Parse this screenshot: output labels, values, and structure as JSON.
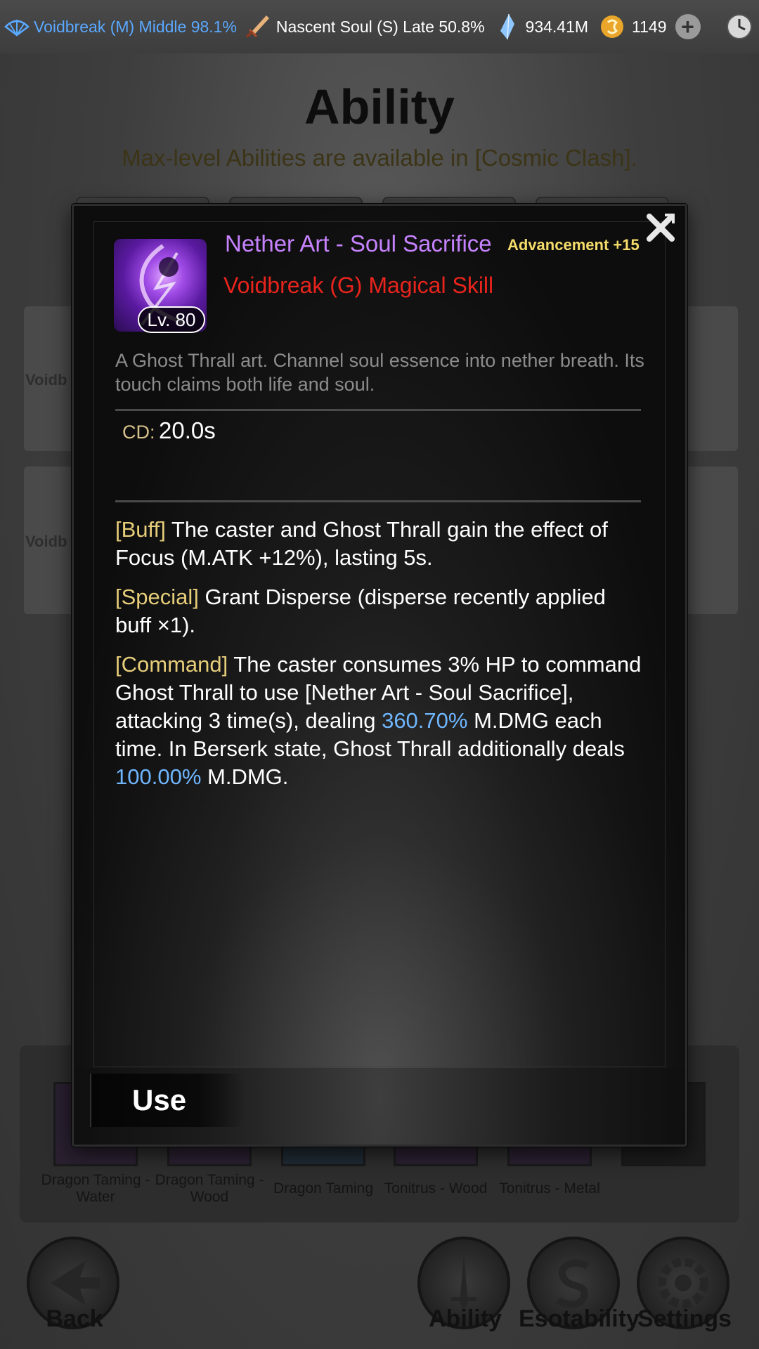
{
  "topbar": {
    "cultivation": "Voidbreak (M) Middle 98.1%",
    "nascent_soul": "Nascent Soul (S) Late 50.8%",
    "spirit_stones": "934.41M",
    "currency": "1149",
    "plus": "+"
  },
  "page": {
    "title": "Ability",
    "notice": "Max-level Abilities are available in [Cosmic Clash].",
    "cards": [
      {
        "label": "Voidb"
      },
      {
        "label": "Voidb"
      }
    ],
    "strip": [
      {
        "label": "Dragon Taming - Water"
      },
      {
        "label": "Dragon Taming - Wood"
      },
      {
        "label": "Dragon Taming"
      },
      {
        "label": "Tonitrus - Wood"
      },
      {
        "label": "Tonitrus - Metal"
      },
      {
        "label": ""
      }
    ],
    "bottom_nav": {
      "back": "Back",
      "ability": "Ability",
      "esotability": "Esotability",
      "settings": "Settings"
    }
  },
  "dialog": {
    "skill_name": "Nether Art - Soul Sacrifice",
    "advancement": "Advancement +15",
    "skill_type": "Voidbreak (G) Magical Skill",
    "level": "Lv. 80",
    "lore": "A Ghost Thrall art. Channel soul essence into nether breath. Its touch claims both life and soul.",
    "cd_label": "CD:",
    "cd_value": "20.0s",
    "effects": {
      "buff_tag": "[Buff]",
      "buff_text": " The caster and Ghost Thrall gain the effect of Focus (M.ATK +12%), lasting 5s.",
      "special_tag": "[Special]",
      "special_text": " Grant Disperse (disperse recently applied buff ×1).",
      "command_tag": "[Command]",
      "command_text_1": " The caster consumes 3% HP to command Ghost Thrall to use [Nether Art - Soul Sacrifice], attacking 3 time(s), dealing ",
      "command_value_1": "360.70%",
      "command_text_2": " M.DMG each time. In Berserk state, Ghost Thrall additionally deals ",
      "command_value_2": "100.00%",
      "command_text_3": " M.DMG."
    },
    "use_label": "Use"
  },
  "colors": {
    "cultivation": "#5aa8ff",
    "skill_name": "#c783ff",
    "skill_type": "#e8241d",
    "advancement": "#f5dc6a",
    "tag": "#e6cd7a",
    "highlight": "#6fb6ff"
  },
  "icons": [
    "fan-icon",
    "sword-icon",
    "crystal-icon",
    "coin-icon",
    "plus-icon",
    "clock-icon",
    "close-icon",
    "skill-portrait",
    "back-arrow-icon",
    "ability-icon",
    "esotability-icon",
    "settings-icon"
  ]
}
